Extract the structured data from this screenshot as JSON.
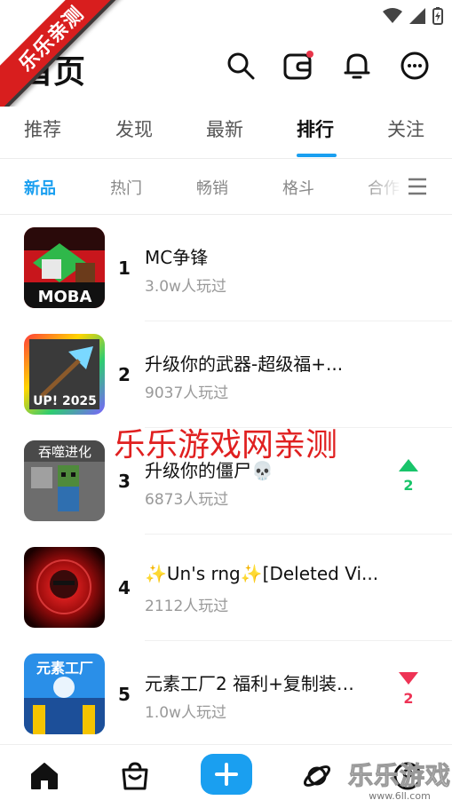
{
  "ribbon": {
    "text": "乐乐亲测"
  },
  "header": {
    "title": "首页"
  },
  "tabs": [
    {
      "label": "推荐",
      "active": false
    },
    {
      "label": "发现",
      "active": false
    },
    {
      "label": "最新",
      "active": false
    },
    {
      "label": "排行",
      "active": true
    },
    {
      "label": "关注",
      "active": false
    }
  ],
  "subtabs": [
    {
      "label": "新品",
      "active": true
    },
    {
      "label": "热门",
      "active": false
    },
    {
      "label": "畅销",
      "active": false
    },
    {
      "label": "格斗",
      "active": false
    },
    {
      "label": "合作",
      "active": false
    }
  ],
  "games": [
    {
      "rank": "1",
      "name": "MC争锋",
      "plays": "3.0w人玩过",
      "thumb_text": "MOBA",
      "trend": null
    },
    {
      "rank": "2",
      "name": "升级你的武器-超级福+...",
      "plays": "9037人玩过",
      "thumb_text": "UP! 2025",
      "trend": null
    },
    {
      "rank": "3",
      "name": "升级你的僵尸💀",
      "plays": "6873人玩过",
      "thumb_text": "吞噬进化",
      "trend": {
        "direction": "up",
        "value": "2"
      }
    },
    {
      "rank": "4",
      "name": "✨Un's rng✨[Deleted Vi...",
      "plays": "2112人玩过",
      "thumb_text": "",
      "trend": null
    },
    {
      "rank": "5",
      "name": "元素工厂2 福利+复制装…",
      "plays": "1.0w人玩过",
      "thumb_text": "元素工厂",
      "trend": {
        "direction": "down",
        "value": "2"
      }
    }
  ],
  "watermark": {
    "text": "乐乐游戏网亲测"
  },
  "watermark_logo": {
    "text": "乐乐游戏",
    "url": "www.6ll.com"
  },
  "colors": {
    "accent": "#1a9ff0",
    "up": "#18c46a",
    "down": "#ee3355",
    "badge": "#e8354a"
  }
}
